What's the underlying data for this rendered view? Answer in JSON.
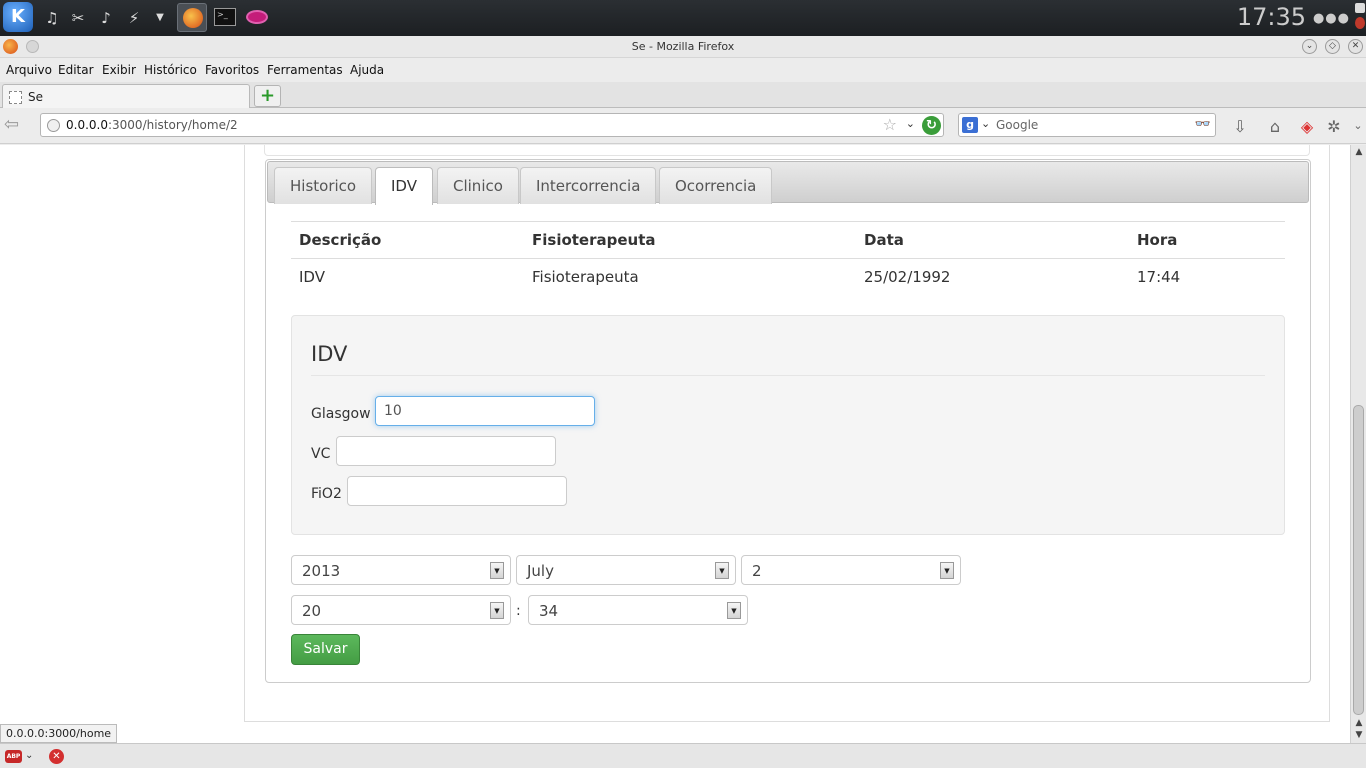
{
  "system_panel": {
    "launcher_icon": "kde-k-icon",
    "clock": "17:35",
    "more": "●●●"
  },
  "window": {
    "title": "Se - Mozilla Firefox"
  },
  "menubar": {
    "items": [
      "Arquivo",
      "Editar",
      "Exibir",
      "Histórico",
      "Favoritos",
      "Ferramentas",
      "Ajuda"
    ]
  },
  "browser": {
    "tab_label": "Se",
    "new_tab": "+",
    "url_host": "0.0.0.0",
    "url_path": ":3000/history/home/2",
    "search_placeholder": "Google",
    "status_link": "0.0.0.0:3000/home"
  },
  "page": {
    "tabs": [
      "Historico",
      "IDV",
      "Clinico",
      "Intercorrencia",
      "Ocorrencia"
    ],
    "active_tab": "IDV",
    "table": {
      "headers": [
        "Descrição",
        "Fisioterapeuta",
        "Data",
        "Hora"
      ],
      "rows": [
        [
          "IDV",
          "Fisioterapeuta",
          "25/02/1992",
          "17:44"
        ]
      ]
    },
    "form": {
      "legend": "IDV",
      "glasgow_label": "Glasgow",
      "glasgow_value": "10",
      "vc_label": "VC",
      "vc_value": "",
      "fio2_label": "FiO2",
      "fio2_value": ""
    },
    "datetime": {
      "year": "2013",
      "month": "July",
      "day": "2",
      "hour": "20",
      "separator": ":",
      "minute": "34"
    },
    "save_label": "Salvar"
  },
  "colors": {
    "save_button": "#5cb85c",
    "focus_ring": "#66afe9",
    "reload": "#3a9d3a"
  }
}
